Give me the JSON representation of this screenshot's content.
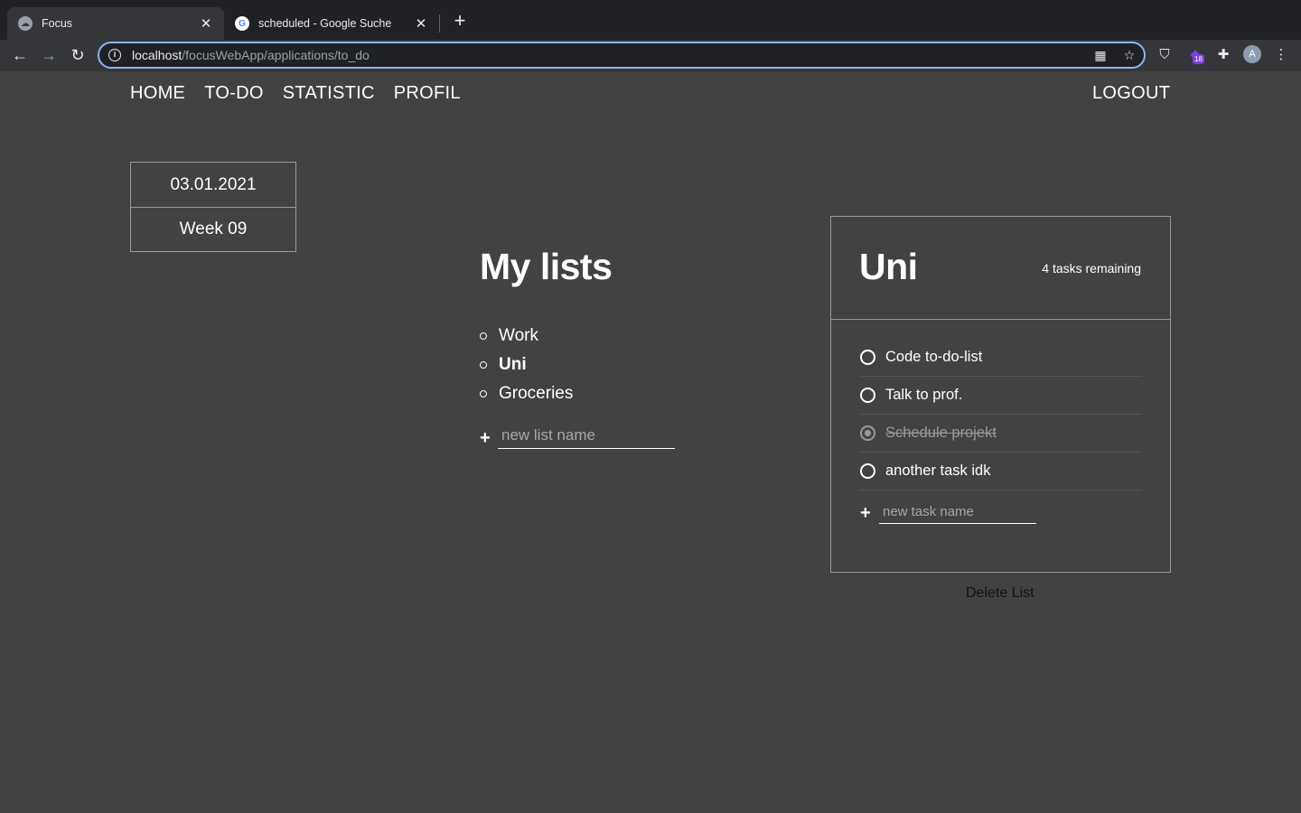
{
  "browser": {
    "tabs": [
      {
        "title": "Focus",
        "active": true
      },
      {
        "title": "scheduled - Google Suche",
        "active": false
      }
    ],
    "url_host": "localhost",
    "url_path": "/focusWebApp/applications/to_do",
    "extension_badge": "18",
    "avatar_letter": "A"
  },
  "nav": {
    "items": [
      "HOME",
      "TO-DO",
      "STATISTIC",
      "PROFIL"
    ],
    "logout": "LOGOUT"
  },
  "datebox": {
    "date": "03.01.2021",
    "week": "Week 09"
  },
  "lists": {
    "title": "My lists",
    "items": [
      {
        "label": "Work",
        "active": false
      },
      {
        "label": "Uni",
        "active": true
      },
      {
        "label": "Groceries",
        "active": false
      }
    ],
    "new_placeholder": "new list name"
  },
  "panel": {
    "title": "Uni",
    "remaining": "4 tasks remaining",
    "tasks": [
      {
        "label": "Code to-do-list",
        "done": false
      },
      {
        "label": "Talk to prof.",
        "done": false
      },
      {
        "label": "Schedule projekt",
        "done": true
      },
      {
        "label": "another task idk",
        "done": false
      }
    ],
    "new_placeholder": "new task name",
    "delete": "Delete List"
  }
}
